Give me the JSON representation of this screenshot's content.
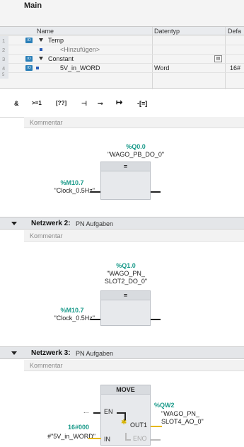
{
  "iface": {
    "title": "Main",
    "headers": {
      "name": "Name",
      "type": "Datentyp",
      "default": "Defa"
    },
    "rows": [
      {
        "num": "1",
        "name": "Temp",
        "type": "",
        "default": ""
      },
      {
        "num": "2",
        "name": "<Hinzufügen>",
        "type": "",
        "default": ""
      },
      {
        "num": "3",
        "name": "Constant",
        "type": "",
        "default": ""
      },
      {
        "num": "4",
        "name": "5V_in_WORD",
        "type": "Word",
        "default": "16#"
      },
      {
        "num": "5",
        "name": "",
        "type": "",
        "default": ""
      }
    ]
  },
  "toolbar": {
    "items": [
      "&",
      ">=1",
      "[??]",
      "⊣",
      "⊸",
      "↦",
      "-[=]"
    ]
  },
  "networks": [
    {
      "title": "",
      "subtitle": "",
      "comment": "Kommentar",
      "out_addr": "%Q0.0",
      "out_symbol": "\"WAGO_PB_DO_0\"",
      "op": "=",
      "in_addr": "%M10.7",
      "in_symbol": "\"Clock_0.5Hz\""
    },
    {
      "title": "Netzwerk 2:",
      "subtitle": "PN Aufgaben",
      "comment": "Kommentar",
      "out_addr": "%Q1.0",
      "out_symbol_1": "\"WAGO_PN_",
      "out_symbol_2": "SLOT2_DO_0\"",
      "op": "=",
      "in_addr": "%M10.7",
      "in_symbol": "\"Clock_0.5Hz\""
    },
    {
      "title": "Netzwerk 3:",
      "subtitle": "PN Aufgaben",
      "comment": "Kommentar",
      "block": "MOVE",
      "pin_en": "EN",
      "pin_in": "IN",
      "pin_out": "OUT1",
      "pin_eno": "ENO",
      "en_dots": "...",
      "in_const": "16#000",
      "in_symbol": "#\"5V_in_WORD\"",
      "out_addr": "%QW2",
      "out_symbol_1": "\"WAGO_PN_",
      "out_symbol_2": "SLOT4_AO_0\""
    }
  ]
}
